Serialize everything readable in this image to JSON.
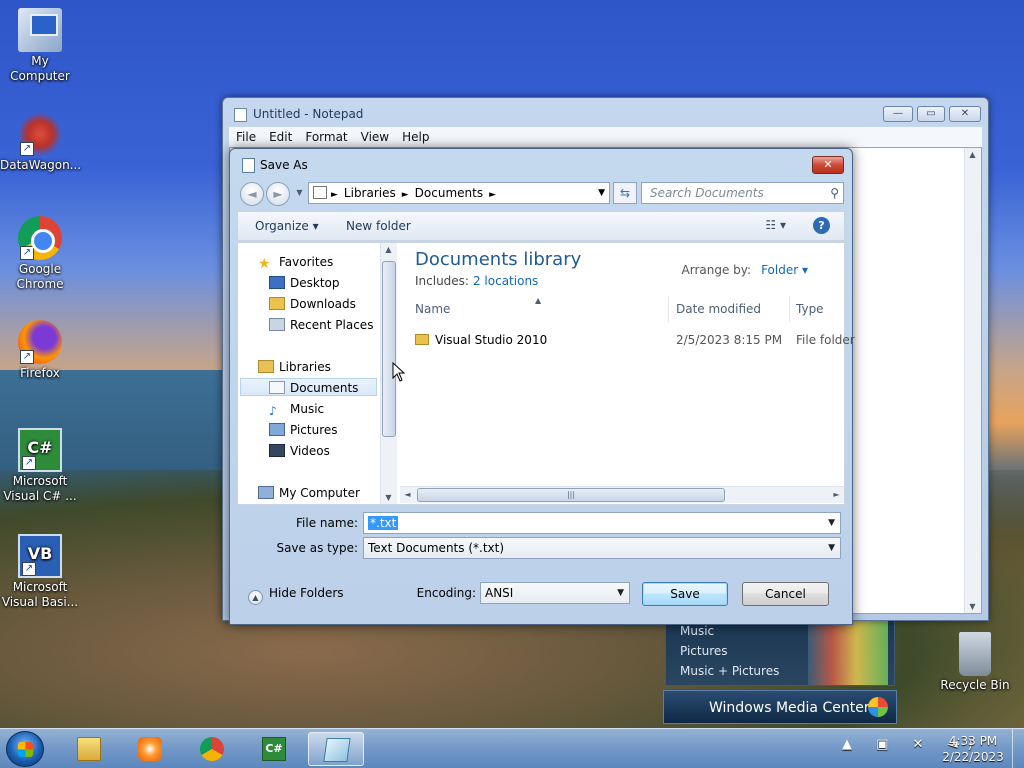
{
  "desktop": {
    "icons": [
      {
        "label": "My Computer",
        "icon": "computer-icon"
      },
      {
        "label": "DataWagon...",
        "icon": "datawagon-icon"
      },
      {
        "label": "Google Chrome",
        "icon": "chrome-icon"
      },
      {
        "label": "Firefox",
        "icon": "firefox-icon"
      },
      {
        "label": "Microsoft Visual C# ...",
        "icon": "csharp-icon"
      },
      {
        "label": "Microsoft Visual Basi...",
        "icon": "vb-icon"
      },
      {
        "label": "Recycle Bin",
        "icon": "recycle-bin-icon"
      }
    ]
  },
  "notepad": {
    "title": "Untitled - Notepad",
    "menu": [
      "File",
      "Edit",
      "Format",
      "View",
      "Help"
    ],
    "controls": {
      "minimize": "—",
      "maximize": "▭",
      "close": "✕"
    }
  },
  "media_center": {
    "menu": [
      "Music",
      "Pictures",
      "Music + Pictures"
    ],
    "bar_label": "Windows Media Center"
  },
  "dialog": {
    "title": "Save As",
    "close": "✕",
    "address": {
      "crumbs": [
        "Libraries",
        "Documents"
      ],
      "sep": "►"
    },
    "search_placeholder": "Search Documents",
    "toolbar": {
      "organize": "Organize ▾",
      "new_folder": "New folder",
      "view": "☷ ▾",
      "help": "?"
    },
    "nav": {
      "favorites": "Favorites",
      "desktop": "Desktop",
      "downloads": "Downloads",
      "recent": "Recent Places",
      "libraries": "Libraries",
      "documents": "Documents",
      "music": "Music",
      "pictures": "Pictures",
      "videos": "Videos",
      "my_computer": "My Computer"
    },
    "library": {
      "title": "Documents library",
      "includes_label": "Includes:",
      "includes_link": "2 locations",
      "arrange_label": "Arrange by:",
      "arrange_value": "Folder ▾"
    },
    "columns": {
      "name": "Name",
      "date": "Date modified",
      "type": "Type"
    },
    "files": [
      {
        "name": "Visual Studio 2010",
        "date": "2/5/2023 8:15 PM",
        "type": "File folder"
      }
    ],
    "file_name_label": "File name:",
    "file_name_value": "*.txt",
    "save_type_label": "Save as type:",
    "save_type_value": "Text Documents (*.txt)",
    "hide_folders": "Hide Folders",
    "encoding_label": "Encoding:",
    "encoding_value": "ANSI",
    "save": "Save",
    "cancel": "Cancel"
  },
  "taskbar": {
    "apps": [
      "Windows Explorer",
      "Windows Media Player",
      "Google Chrome",
      "Microsoft Visual C#",
      "Notepad"
    ],
    "tray": "▲ ▣ ✕ ◄)",
    "time": "4:33 PM",
    "date": "2/22/2023"
  }
}
